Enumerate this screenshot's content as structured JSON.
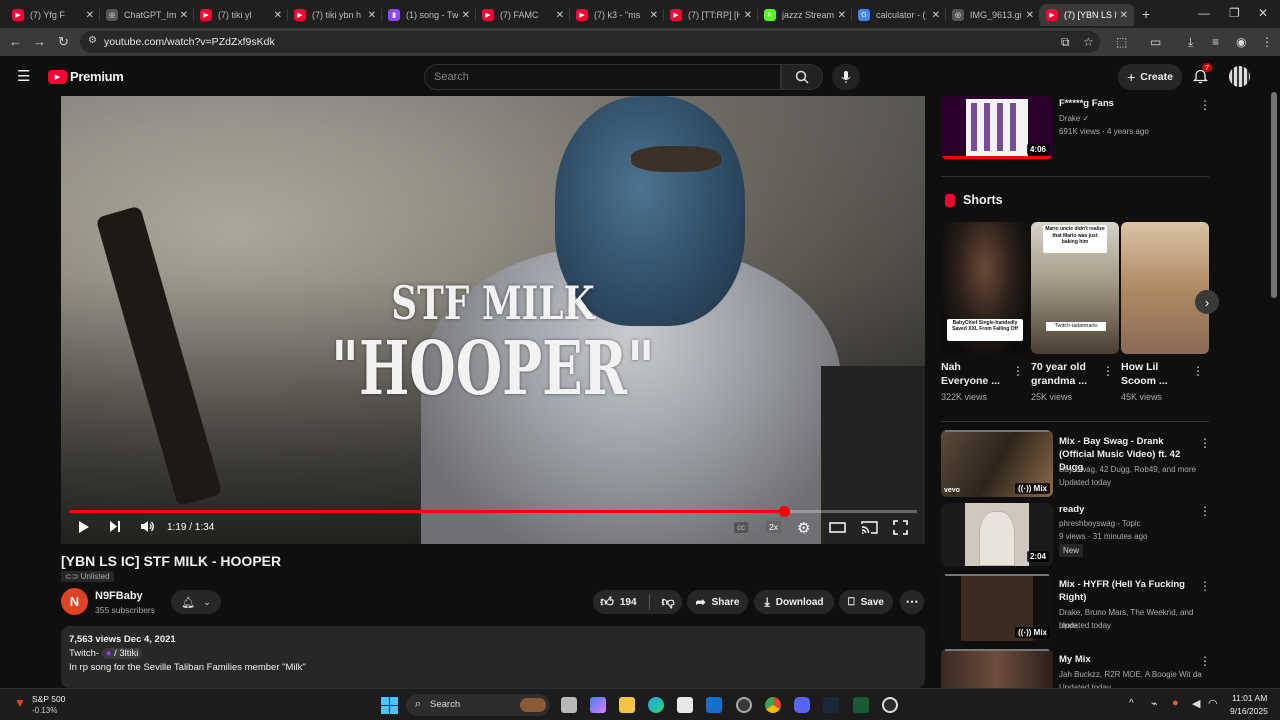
{
  "browser": {
    "tabs": [
      {
        "label": "(7) Yfg F",
        "color": "#ff0033",
        "glyph": "▶"
      },
      {
        "label": "ChatGPT_Im",
        "color": "#555555",
        "glyph": "◎"
      },
      {
        "label": "(7) tiki yl",
        "color": "#ff0033",
        "glyph": "▶"
      },
      {
        "label": "(7) tiki ybn h",
        "color": "#ff0033",
        "glyph": "▶"
      },
      {
        "label": "(1) song - Tw",
        "color": "#9146ff",
        "glyph": "▮"
      },
      {
        "label": "(7) FAMC",
        "color": "#ff0033",
        "glyph": "▶"
      },
      {
        "label": "(7) k3 - \"ms",
        "color": "#ff0033",
        "glyph": "▶"
      },
      {
        "label": "(7) [TT:RP] [H",
        "color": "#ff0033",
        "glyph": "▶"
      },
      {
        "label": "jazzz Stream",
        "color": "#53fc18",
        "glyph": "K"
      },
      {
        "label": "calculator - (",
        "color": "#4285f4",
        "glyph": "G"
      },
      {
        "label": "IMG_9613.gi",
        "color": "#555555",
        "glyph": "◎"
      },
      {
        "label": "(7) [YBN LS I",
        "color": "#ff0033",
        "glyph": "▶"
      }
    ],
    "url": "youtube.com/watch?v=PZdZxf9sKdk"
  },
  "yt": {
    "logo_text": "Premium",
    "search_placeholder": "Search",
    "create_label": "Create",
    "notif_count": "7"
  },
  "player": {
    "overlay_line1": "STF MILK",
    "overlay_line2": "\"HOOPER\"",
    "time": "1:19 / 1:34",
    "progress": 0.843,
    "speed_badge": "2x"
  },
  "video": {
    "title": "[YBN LS IC] STF MILK - HOOPER",
    "unlisted": "Unlisted",
    "channel_initial": "N",
    "channel": "N9FBaby",
    "subscribers": "355 subscribers",
    "likes": "194",
    "share": "Share",
    "download": "Download",
    "save": "Save",
    "desc_stats": "7,563 views  Dec 4, 2021",
    "desc_twitch_prefix": "Twitch-",
    "desc_twitch_handle": "/ 3ltiki",
    "desc_text": "In rp song for the Seville Taliban Families member \"Milk\""
  },
  "sidebar": {
    "top_video": {
      "title": "F*****g Fans",
      "channel": "Drake",
      "meta": "691K views · 4 years ago",
      "duration": "4:06"
    },
    "shorts_heading": "Shorts",
    "shorts": [
      {
        "title": "Nah Everyone ...",
        "views": "322K views",
        "caption": "BabyChief Single-handedly Saved XXL From Falling Off"
      },
      {
        "title": "70 year old grandma ...",
        "views": "25K views",
        "caption": "Mario uncle didn't realize that Mario was just baking him"
      },
      {
        "title": "How Lil Scoom ...",
        "views": "45K views",
        "caption": ""
      }
    ],
    "videos": [
      {
        "title": "Mix - Bay Swag - Drank (Official Music Video) ft. 42 Dugg",
        "meta1": "Bay Swag, 42 Dugg, Rob49, and more",
        "meta2": "Updated today",
        "badge": "Mix"
      },
      {
        "title": "ready",
        "meta1": "phreshboyswag - Topic",
        "meta2": "9 views · 31 minutes ago",
        "new": "New",
        "badge": "2:04"
      },
      {
        "title": "Mix - HYFR (Hell Ya Fucking Right)",
        "meta1": "Drake, Bruno Mars, The Weeknd, and more",
        "meta2": "Updated today",
        "badge": "Mix"
      },
      {
        "title": "My Mix",
        "meta1": "Jah Buckzz, R2R MOE, A Boogie Wit da ...",
        "meta2": "Updated today",
        "badge": ""
      }
    ],
    "twitch_caption": "Twitch-iadatmarlo"
  },
  "taskbar": {
    "stock_name": "S&P 500",
    "stock_change": "-0.13%",
    "search": "Search",
    "time": "11:01 AM",
    "date": "9/16/2025"
  }
}
